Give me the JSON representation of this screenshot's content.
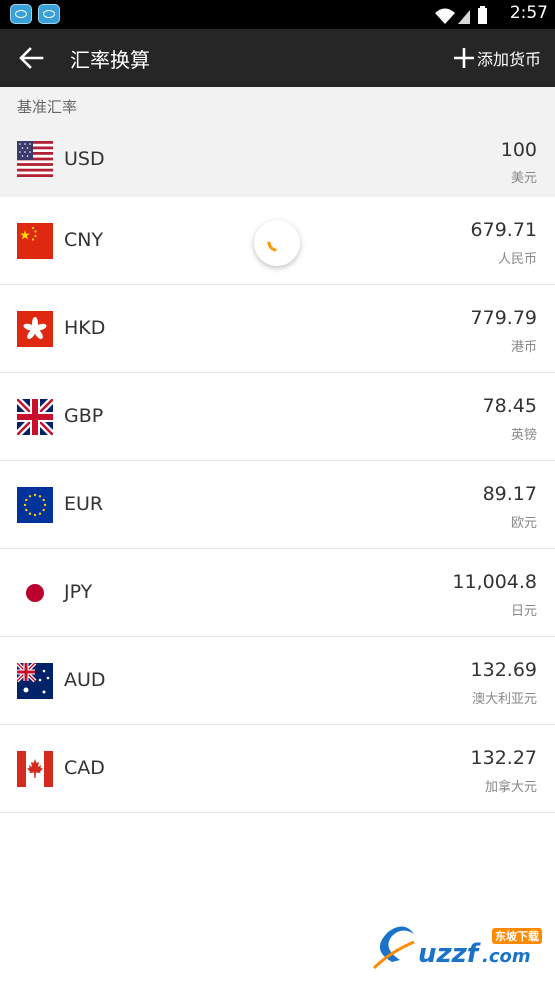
{
  "status_bar": {
    "time": "2:57"
  },
  "toolbar": {
    "title": "汇率换算",
    "add_label": "添加货币"
  },
  "section": {
    "base_label": "基准汇率"
  },
  "base": {
    "code": "USD",
    "amount": "100",
    "name": "美元",
    "flag": "us-flag-icon"
  },
  "currencies": [
    {
      "code": "CNY",
      "amount": "679.71",
      "name": "人民币",
      "flag": "cn-flag-icon"
    },
    {
      "code": "HKD",
      "amount": "779.79",
      "name": "港币",
      "flag": "hk-flag-icon"
    },
    {
      "code": "GBP",
      "amount": "78.45",
      "name": "英镑",
      "flag": "gb-flag-icon"
    },
    {
      "code": "EUR",
      "amount": "89.17",
      "name": "欧元",
      "flag": "eu-flag-icon"
    },
    {
      "code": "JPY",
      "amount": "11,004.8",
      "name": "日元",
      "flag": "jp-flag-icon"
    },
    {
      "code": "AUD",
      "amount": "132.69",
      "name": "澳大利亚元",
      "flag": "au-flag-icon"
    },
    {
      "code": "CAD",
      "amount": "132.27",
      "name": "加拿大元",
      "flag": "ca-flag-icon"
    }
  ],
  "watermark": {
    "brand": "uzzf.com",
    "tag": "东坡下载"
  },
  "colors": {
    "toolbar": "#262626",
    "status_bar": "#000000",
    "base_row": "#f2f2f2",
    "spinner": "#ff9800"
  }
}
